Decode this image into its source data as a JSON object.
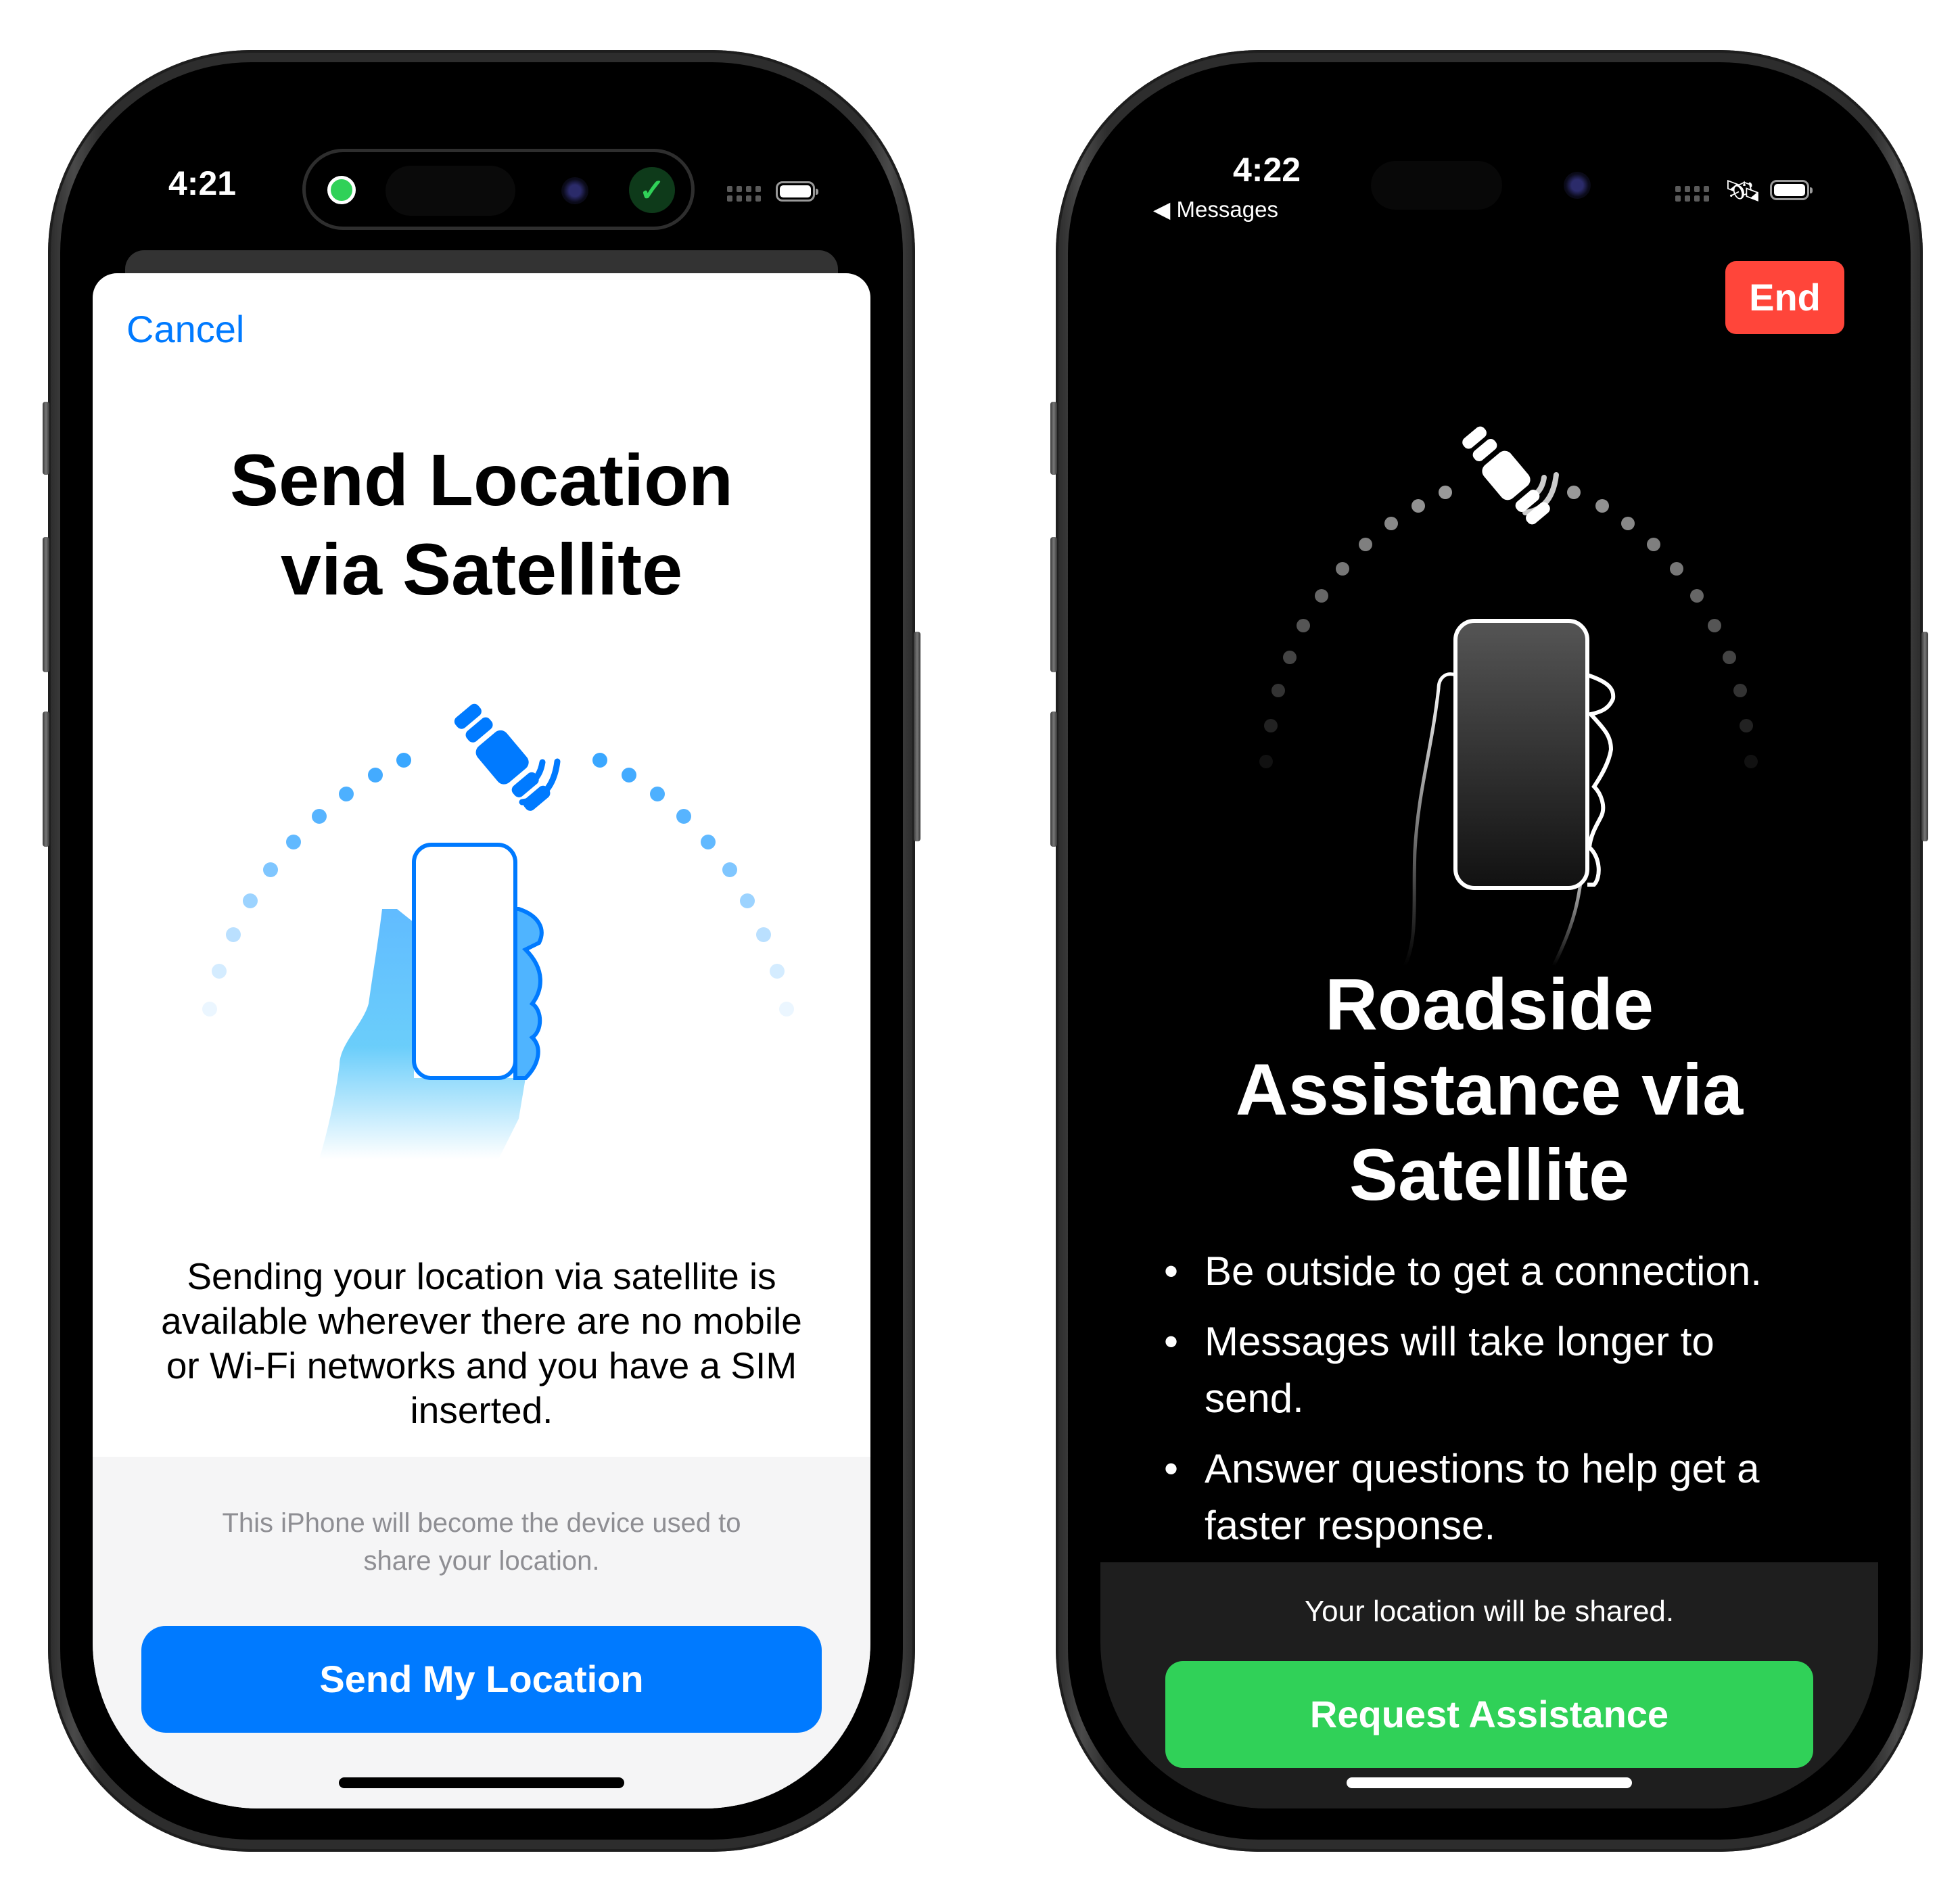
{
  "left_phone": {
    "status_bar": {
      "time": "4:21"
    },
    "dynamic_island": {
      "left_indicator": "green-dot",
      "right_indicator": "checkmark-icon"
    },
    "sheet": {
      "cancel_label": "Cancel",
      "title_line1": "Send Location",
      "title_line2": "via Satellite",
      "description": "Sending your location via satellite is available wherever there are no mobile or Wi-Fi networks and you have a SIM inserted.",
      "footer_note": "This iPhone will become the device used to share your location.",
      "primary_button_label": "Send My Location"
    },
    "colors": {
      "accent": "#007AFF",
      "sheet_bg": "#FFFFFF",
      "footer_bg": "#F5F5F6",
      "note_text": "#8E8E93"
    }
  },
  "right_phone": {
    "status_bar": {
      "time": "4:22",
      "back_label": "Messages",
      "satellite_indicator": "satellite-icon"
    },
    "end_button_label": "End",
    "title_line1": "Roadside",
    "title_line2": "Assistance via",
    "title_line3": "Satellite",
    "bullets": [
      "Be outside to get a connection.",
      "Messages will take longer to send.",
      "Answer questions to help get a faster response."
    ],
    "footer_note": "Your location will be shared.",
    "primary_button_label": "Request Assistance",
    "colors": {
      "end": "#FF453A",
      "primary": "#30D158",
      "bg": "#000000",
      "footer_bg": "#1E1E1E"
    }
  }
}
